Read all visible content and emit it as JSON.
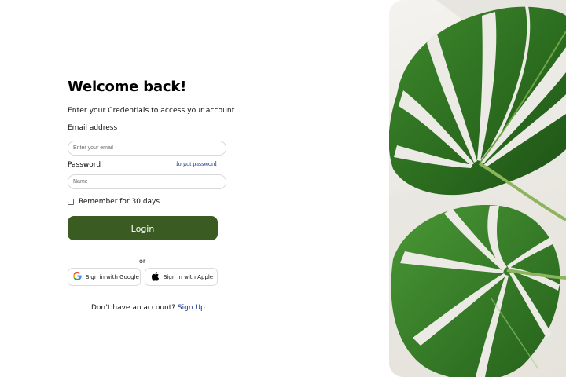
{
  "header": {
    "title": "Welcome back!",
    "subtitle": "Enter your Credentials to access your account"
  },
  "form": {
    "email_label": "Email address",
    "email_placeholder": "Enter your email",
    "password_label": "Password",
    "forgot_password": "forgot password",
    "password_placeholder": "Name",
    "remember_label": "Remember for 30 days",
    "remember_checked": false,
    "login_label": "Login"
  },
  "divider": {
    "or_label": "or"
  },
  "social": {
    "google_label": "Sign in with Google",
    "apple_label": "Sign in with Apple"
  },
  "signup": {
    "prompt": "Don’t have an account?",
    "link": "Sign Up"
  },
  "colors": {
    "primary": "#3a5b22",
    "link": "#1a3a8f",
    "border": "#d9d9d9"
  },
  "icons": {
    "google": "google-icon",
    "apple": "apple-icon"
  }
}
